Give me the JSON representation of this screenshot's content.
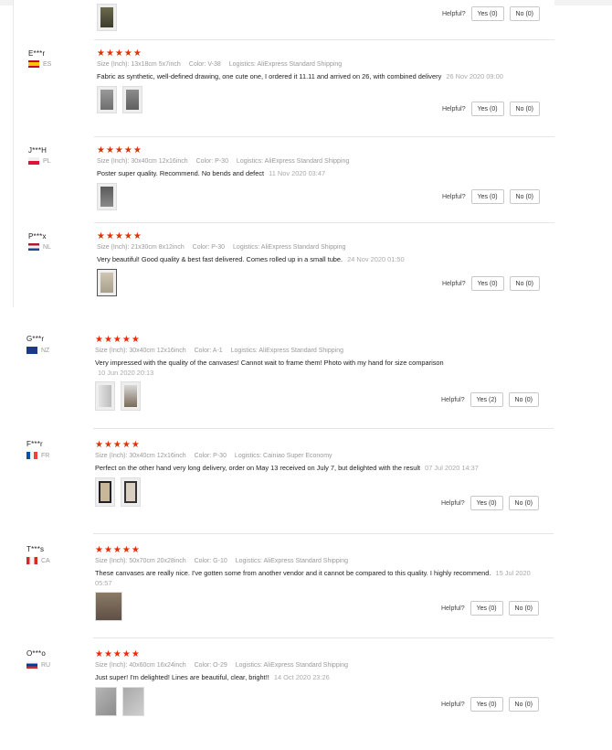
{
  "helpful_label": "Helpful?",
  "reviews_top": [
    {
      "user": "",
      "country": "",
      "stars": "",
      "size": "",
      "color": "",
      "logistics": "",
      "text": "",
      "date": "",
      "yes": "Yes (0)",
      "no": "No (0)"
    },
    {
      "user": "E***r",
      "country": "ES",
      "stars": "★★★★★",
      "size": "Size (Inch): 13x18cm 5x7inch",
      "color": "Color: V-38",
      "logistics": "Logistics: AliExpress Standard Shipping",
      "text": "Fabric as synthetic, well-defined drawing, one cute one, I ordered it 11.11 and arrived on 26, with combined delivery",
      "date": "26 Nov 2020 09:00",
      "yes": "Yes (0)",
      "no": "No (0)"
    },
    {
      "user": "J***H",
      "country": "PL",
      "stars": "★★★★★",
      "size": "Size (Inch): 30x40cm 12x16inch",
      "color": "Color: P-30",
      "logistics": "Logistics: AliExpress Standard Shipping",
      "text": "Poster super quality. Recommend. No bends and defect",
      "date": "11 Nov 2020 03:47",
      "yes": "Yes (0)",
      "no": "No (0)"
    },
    {
      "user": "P***x",
      "country": "NL",
      "stars": "★★★★★",
      "size": "Size (Inch): 21x30cm 8x12inch",
      "color": "Color: P-30",
      "logistics": "Logistics: AliExpress Standard Shipping",
      "text": "Very beautiful! Good quality & best fast delivered. Comes rolled up in a small tube.",
      "date": "24 Nov 2020 01:50",
      "yes": "Yes (0)",
      "no": "No (0)"
    }
  ],
  "reviews_bottom": [
    {
      "user": "G***r",
      "country": "NZ",
      "stars": "★★★★★",
      "size": "Size (Inch): 30x40cm 12x16inch",
      "color": "Color: A-1",
      "logistics": "Logistics: AliExpress Standard Shipping",
      "text": "Very impressed with the quality of the canvases! Cannot wait to frame them! Photo with my hand for size comparison",
      "date": "10 Jun 2020 20:13",
      "yes": "Yes (2)",
      "no": "No (0)"
    },
    {
      "user": "F***r",
      "country": "FR",
      "stars": "★★★★★",
      "size": "Size (Inch): 30x40cm 12x16inch",
      "color": "Color: P-30",
      "logistics": "Logistics: Cainiao Super Economy",
      "text": "Perfect on the other hand very long delivery, order on May 13 received on July 7, but delighted with the result",
      "date": "07 Jul 2020 14:37",
      "yes": "Yes (0)",
      "no": "No (0)"
    },
    {
      "user": "T***s",
      "country": "CA",
      "stars": "★★★★★",
      "size": "Size (Inch): 50x70cm 20x28inch",
      "color": "Color: G-10",
      "logistics": "Logistics: AliExpress Standard Shipping",
      "text": "These canvases are really nice. I've gotten some from another vendor and it cannot be compared to this quality. I highly recommend.",
      "date": "15 Jul 2020 05:57",
      "yes": "Yes (0)",
      "no": "No (0)"
    },
    {
      "user": "O***o",
      "country": "RU",
      "stars": "★★★★★",
      "size": "Size (Inch): 40x60cm 16x24inch",
      "color": "Color: O-29",
      "logistics": "Logistics: AliExpress Standard Shipping",
      "text": "Just super! I'm delighted! Lines are beautiful, clear, bright!!",
      "date": "14 Oct 2020 23:26",
      "yes": "Yes (0)",
      "no": "No (0)"
    }
  ],
  "colors": {
    "star": "#e62e04",
    "meta": "#9a9a9a",
    "border": "#c9c9c9"
  }
}
